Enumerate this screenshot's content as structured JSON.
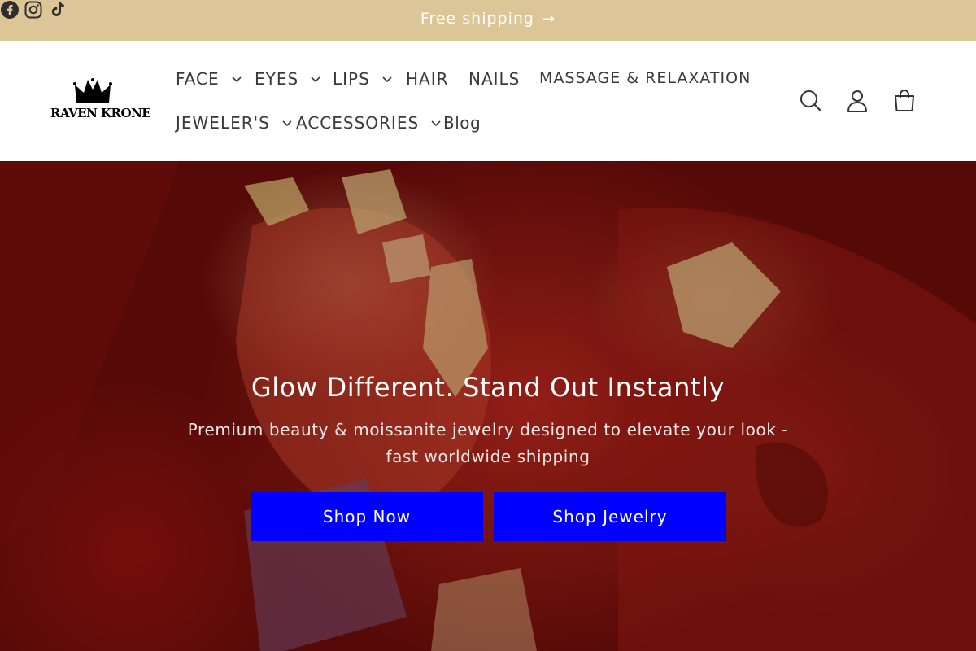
{
  "announcement": {
    "text": "Free shipping",
    "arrow": "→",
    "background": "#dcc597",
    "social": [
      "facebook-icon",
      "instagram-icon",
      "tiktok-icon"
    ]
  },
  "header": {
    "logo_text": "RAVEN KRONE",
    "nav": [
      {
        "label": "FACE",
        "dropdown": true
      },
      {
        "label": "EYES",
        "dropdown": true
      },
      {
        "label": "LIPS",
        "dropdown": true
      },
      {
        "label": "HAIR",
        "dropdown": false
      },
      {
        "label": "NAILS",
        "dropdown": false
      },
      {
        "label": "MASSAGE & RELAXATION",
        "dropdown": false
      },
      {
        "label": "JEWELER'S",
        "dropdown": true
      },
      {
        "label": "ACCESSORIES",
        "dropdown": true
      },
      {
        "label": "Blog",
        "dropdown": false
      }
    ],
    "icons": [
      "search-icon",
      "account-icon",
      "cart-icon"
    ]
  },
  "hero": {
    "title": "Glow Different. Stand Out Instantly",
    "subtitle": "Premium beauty & moissanite jewelry designed to elevate your look - fast worldwide shipping",
    "buttons": [
      {
        "label": "Shop Now"
      },
      {
        "label": "Shop Jewelry"
      }
    ],
    "button_color": "#0000ff"
  }
}
